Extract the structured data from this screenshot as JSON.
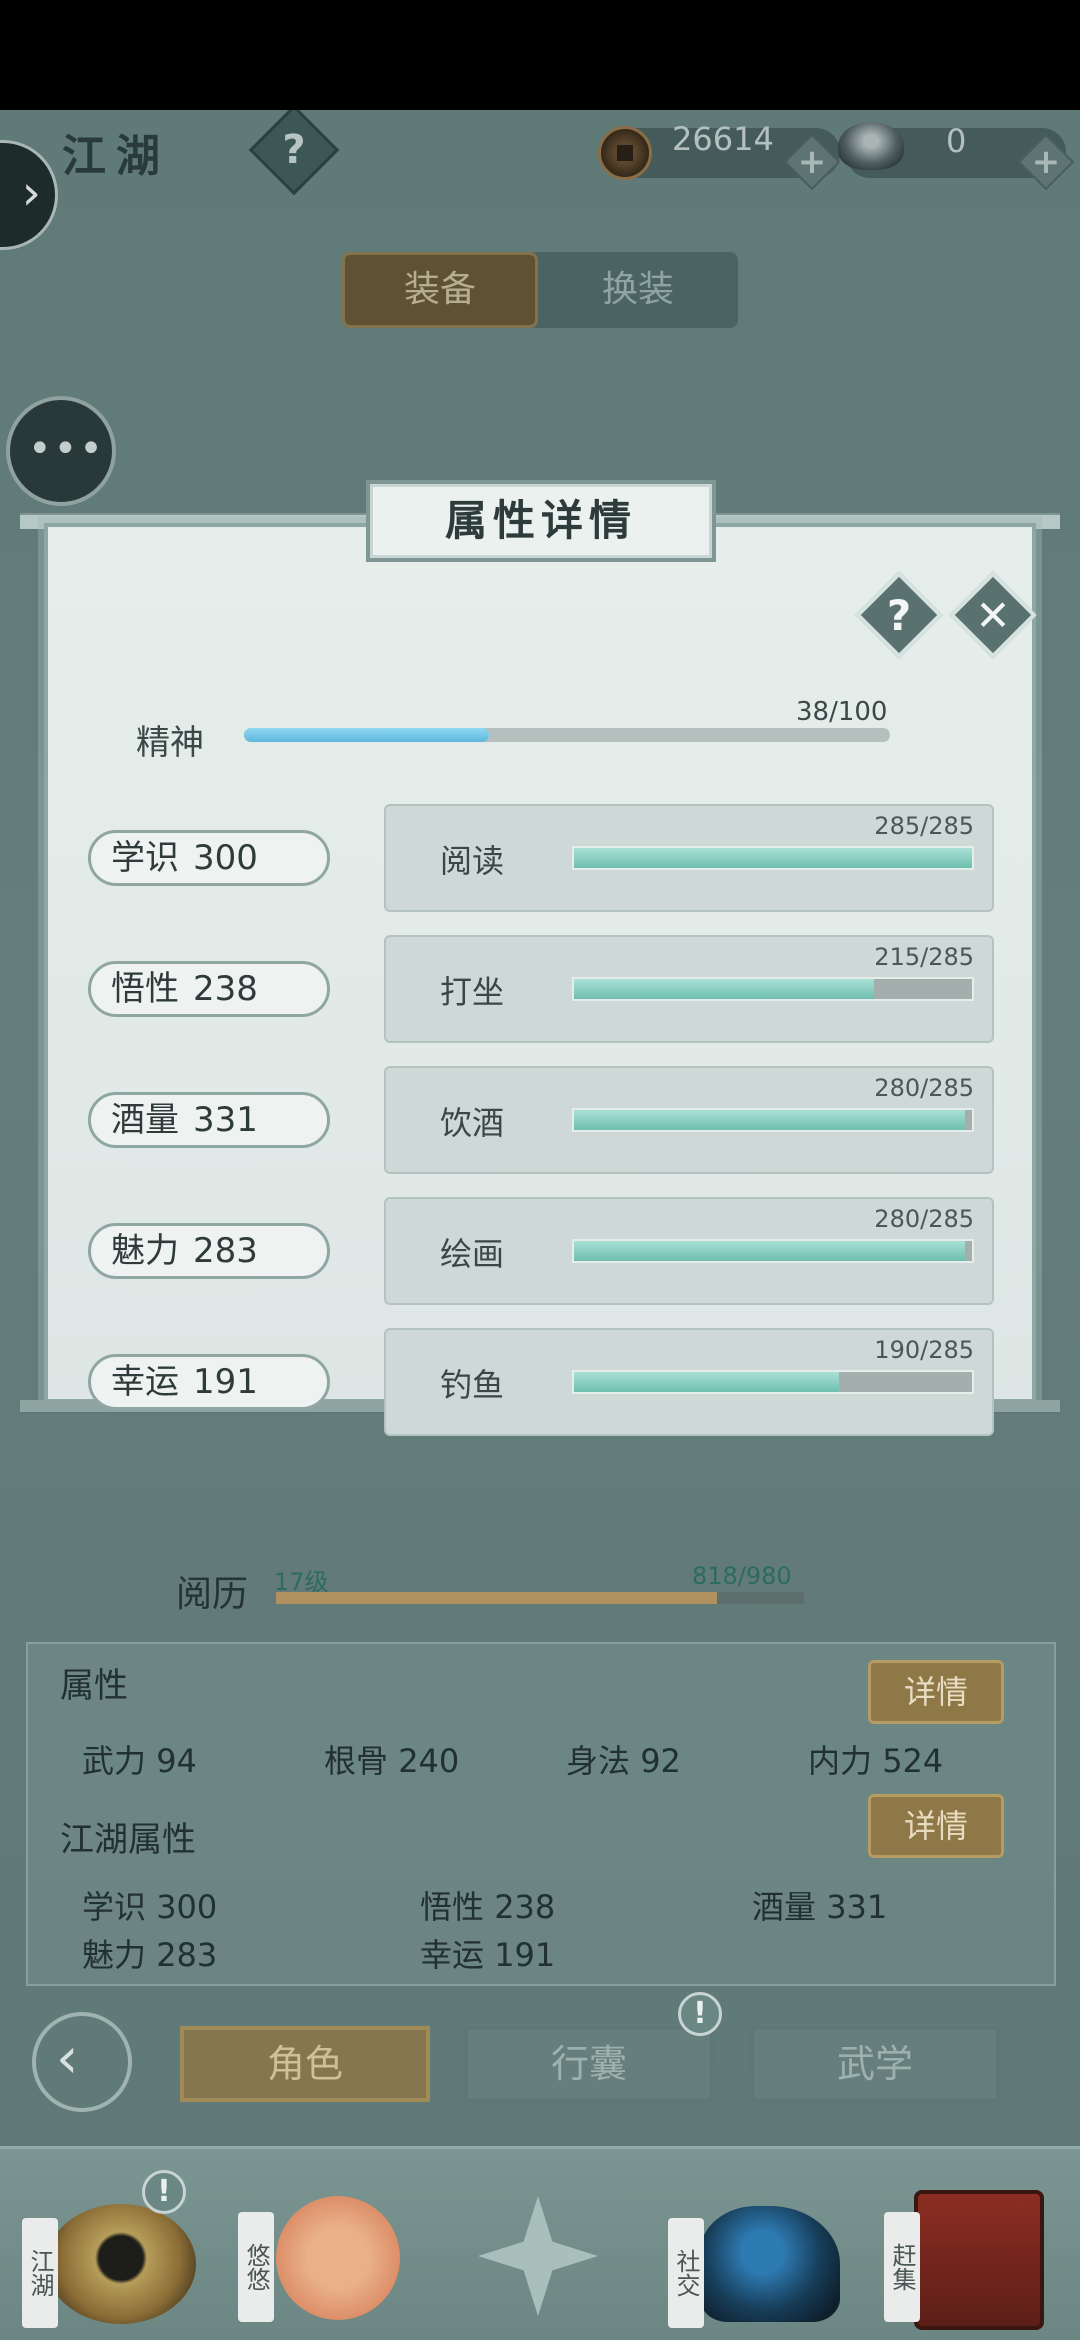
{
  "topbar": {
    "title": "江湖",
    "help": "?",
    "currency": [
      {
        "icon": "copper-coin-icon",
        "value": "26614"
      },
      {
        "icon": "silver-ingot-icon",
        "value": "0"
      }
    ],
    "plus": "+"
  },
  "tabs": {
    "equip": "装备",
    "change": "换装"
  },
  "modal": {
    "title": "属性详情",
    "help": "?",
    "close": "✕",
    "spirit": {
      "label": "精神",
      "current": 38,
      "max": 100,
      "text": "38/100"
    },
    "rows": [
      {
        "attr": "学识",
        "attr_value": "300",
        "skill": "阅读",
        "skill_text": "285/285",
        "current": 285,
        "max": 285
      },
      {
        "attr": "悟性",
        "attr_value": "238",
        "skill": "打坐",
        "skill_text": "215/285",
        "current": 215,
        "max": 285
      },
      {
        "attr": "酒量",
        "attr_value": "331",
        "skill": "饮酒",
        "skill_text": "280/285",
        "current": 280,
        "max": 285
      },
      {
        "attr": "魅力",
        "attr_value": "283",
        "skill": "绘画",
        "skill_text": "280/285",
        "current": 280,
        "max": 285
      },
      {
        "attr": "幸运",
        "attr_value": "191",
        "skill": "钓鱼",
        "skill_text": "190/285",
        "current": 190,
        "max": 285
      }
    ]
  },
  "experience": {
    "label": "阅历",
    "level": "17级",
    "text": "818/980",
    "current": 818,
    "max": 980
  },
  "attributes": {
    "title": "属性",
    "detail": "详情",
    "items": [
      {
        "label": "武力",
        "value": "94"
      },
      {
        "label": "根骨",
        "value": "240"
      },
      {
        "label": "身法",
        "value": "92"
      },
      {
        "label": "内力",
        "value": "524"
      }
    ]
  },
  "jianghu": {
    "title": "江湖属性",
    "detail": "详情",
    "items": [
      {
        "label": "学识",
        "value": "300"
      },
      {
        "label": "悟性",
        "value": "238"
      },
      {
        "label": "酒量",
        "value": "331"
      },
      {
        "label": "魅力",
        "value": "283"
      },
      {
        "label": "幸运",
        "value": "191"
      }
    ]
  },
  "nav": {
    "back": "‹",
    "role": "角色",
    "bag": "行囊",
    "wuxue": "武学",
    "alert": "!"
  },
  "dock": {
    "items": [
      {
        "label": "江湖",
        "icon": "straw-hat-icon"
      },
      {
        "label": "悠悠",
        "icon": "swallow-sun-icon"
      },
      {
        "label": "",
        "icon": "compass-star-icon"
      },
      {
        "label": "社交",
        "icon": "wave-bowl-icon"
      },
      {
        "label": "赶集",
        "icon": "basket-icon"
      }
    ]
  }
}
